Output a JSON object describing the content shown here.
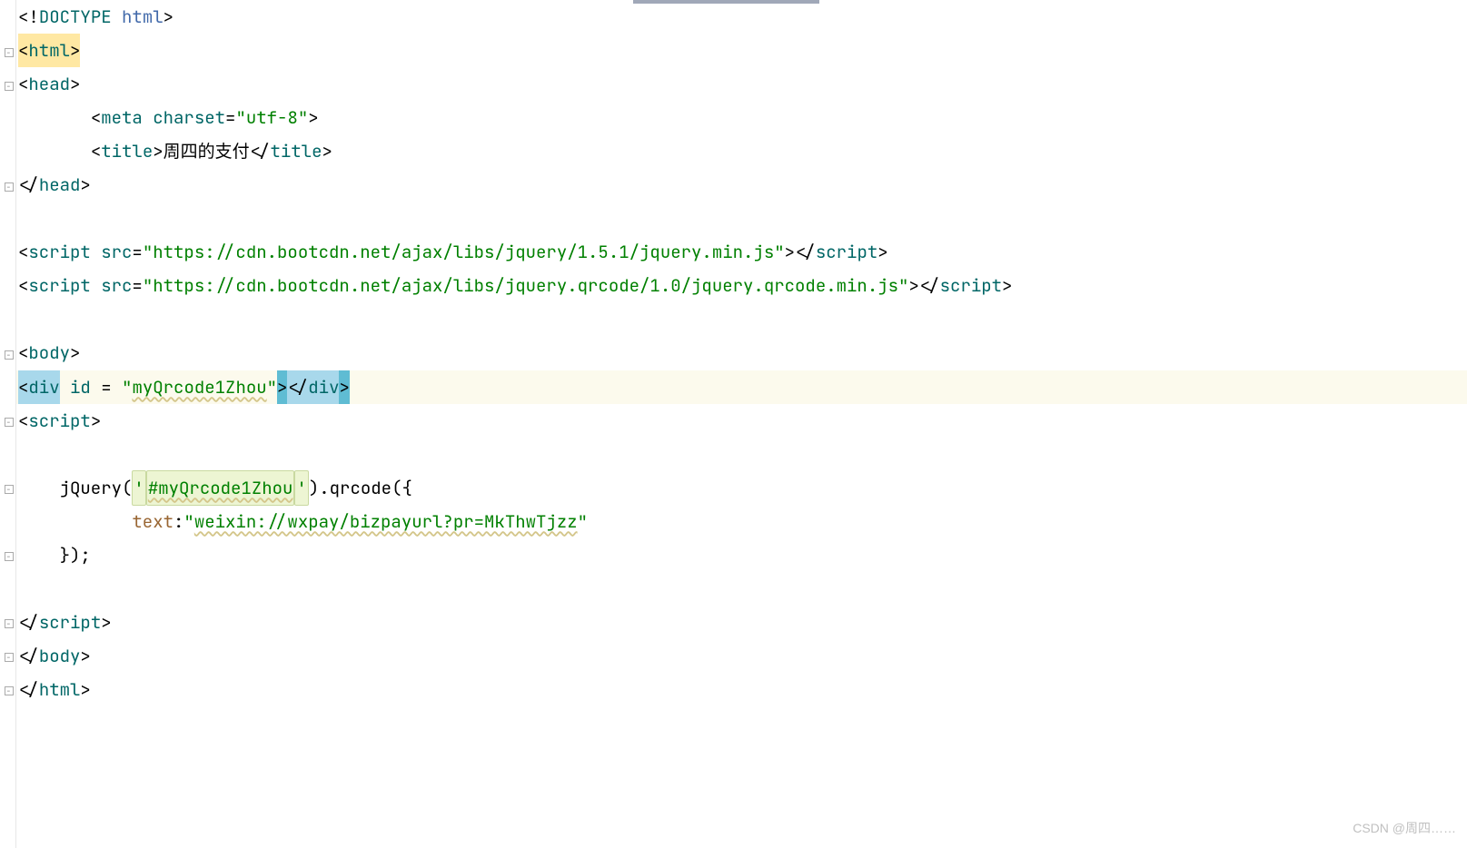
{
  "code": {
    "lines": [
      {
        "fold": "",
        "segments": [
          {
            "text": "<!",
            "cls": "t-bracket"
          },
          {
            "text": "DOCTYPE ",
            "cls": "t-tag"
          },
          {
            "text": "html",
            "cls": "t-identifier"
          },
          {
            "text": ">",
            "cls": "t-bracket"
          }
        ]
      },
      {
        "fold": "open",
        "segments": [
          {
            "text": "<",
            "cls": "t-bracket hl-html"
          },
          {
            "text": "html",
            "cls": "t-tag hl-html"
          },
          {
            "text": ">",
            "cls": "t-bracket hl-html"
          }
        ]
      },
      {
        "fold": "open",
        "segments": [
          {
            "text": "<",
            "cls": "t-bracket"
          },
          {
            "text": "head",
            "cls": "t-tag"
          },
          {
            "text": ">",
            "cls": "t-bracket"
          }
        ]
      },
      {
        "fold": "",
        "segments": [
          {
            "text": "       ",
            "cls": ""
          },
          {
            "text": "<",
            "cls": "t-bracket"
          },
          {
            "text": "meta ",
            "cls": "t-tag"
          },
          {
            "text": "charset",
            "cls": "t-attr"
          },
          {
            "text": "=",
            "cls": "t-punct"
          },
          {
            "text": "\"utf-8\"",
            "cls": "t-string"
          },
          {
            "text": ">",
            "cls": "t-bracket"
          }
        ]
      },
      {
        "fold": "",
        "segments": [
          {
            "text": "       ",
            "cls": ""
          },
          {
            "text": "<",
            "cls": "t-bracket"
          },
          {
            "text": "title",
            "cls": "t-tag"
          },
          {
            "text": ">",
            "cls": "t-bracket"
          },
          {
            "text": "周四的支付",
            "cls": "t-text"
          },
          {
            "text": "</",
            "cls": "t-bracket"
          },
          {
            "text": "title",
            "cls": "t-tag"
          },
          {
            "text": ">",
            "cls": "t-bracket"
          }
        ]
      },
      {
        "fold": "close",
        "segments": [
          {
            "text": "</",
            "cls": "t-bracket"
          },
          {
            "text": "head",
            "cls": "t-tag"
          },
          {
            "text": ">",
            "cls": "t-bracket"
          }
        ]
      },
      {
        "fold": "",
        "segments": [
          {
            "text": " ",
            "cls": ""
          }
        ]
      },
      {
        "fold": "",
        "segments": [
          {
            "text": "<",
            "cls": "t-bracket"
          },
          {
            "text": "script ",
            "cls": "t-tag"
          },
          {
            "text": "src",
            "cls": "t-attr"
          },
          {
            "text": "=",
            "cls": "t-punct"
          },
          {
            "text": "\"https://cdn.bootcdn.net/ajax/libs/jquery/1.5.1/jquery.min.js\"",
            "cls": "t-string"
          },
          {
            "text": "></",
            "cls": "t-bracket"
          },
          {
            "text": "script",
            "cls": "t-tag"
          },
          {
            "text": ">",
            "cls": "t-bracket"
          }
        ]
      },
      {
        "fold": "",
        "segments": [
          {
            "text": "<",
            "cls": "t-bracket"
          },
          {
            "text": "script ",
            "cls": "t-tag"
          },
          {
            "text": "src",
            "cls": "t-attr"
          },
          {
            "text": "=",
            "cls": "t-punct"
          },
          {
            "text": "\"https://cdn.bootcdn.net/ajax/libs/jquery.qrcode/1.0/jquery.qrcode.min.js\"",
            "cls": "t-string"
          },
          {
            "text": "></",
            "cls": "t-bracket"
          },
          {
            "text": "script",
            "cls": "t-tag"
          },
          {
            "text": ">",
            "cls": "t-bracket"
          }
        ]
      },
      {
        "fold": "",
        "segments": [
          {
            "text": " ",
            "cls": ""
          }
        ]
      },
      {
        "fold": "open",
        "segments": [
          {
            "text": "<",
            "cls": "t-bracket"
          },
          {
            "text": "body",
            "cls": "t-tag"
          },
          {
            "text": ">",
            "cls": "t-bracket"
          }
        ]
      },
      {
        "fold": "",
        "current": true,
        "segments": [
          {
            "text": "<",
            "cls": "t-bracket hl-tag-sel"
          },
          {
            "text": "div",
            "cls": "t-tag hl-tag-sel"
          },
          {
            "text": " ",
            "cls": ""
          },
          {
            "text": "id ",
            "cls": "t-attr"
          },
          {
            "text": "= ",
            "cls": "t-punct"
          },
          {
            "text": "\"",
            "cls": "t-string"
          },
          {
            "text": "myQrcode1Zhou",
            "cls": "t-string t-underline-wavy"
          },
          {
            "text": "\"",
            "cls": "t-string"
          },
          {
            "text": ">",
            "cls": "t-bracket hl-tag-sel2"
          },
          {
            "text": "</",
            "cls": "t-bracket hl-tag-sel"
          },
          {
            "text": "div",
            "cls": "t-tag hl-tag-sel"
          },
          {
            "text": ">",
            "cls": "t-bracket hl-tag-sel2"
          }
        ]
      },
      {
        "fold": "open",
        "segments": [
          {
            "text": "<",
            "cls": "t-bracket"
          },
          {
            "text": "script",
            "cls": "t-tag"
          },
          {
            "text": ">",
            "cls": "t-bracket"
          }
        ]
      },
      {
        "fold": "",
        "segments": [
          {
            "text": " ",
            "cls": ""
          }
        ]
      },
      {
        "fold": "open",
        "segments": [
          {
            "text": "    ",
            "cls": ""
          },
          {
            "text": "jQuery",
            "cls": "t-func"
          },
          {
            "text": "(",
            "cls": "t-punct"
          },
          {
            "text": "'",
            "cls": "t-string hl-soft"
          },
          {
            "text": "#myQrcode1Zhou",
            "cls": "t-string hl-soft t-underline-wavy"
          },
          {
            "text": "'",
            "cls": "t-string hl-soft"
          },
          {
            "text": ").",
            "cls": "t-punct"
          },
          {
            "text": "qrcode",
            "cls": "t-func"
          },
          {
            "text": "({",
            "cls": "t-punct"
          }
        ]
      },
      {
        "fold": "",
        "segments": [
          {
            "text": "           ",
            "cls": ""
          },
          {
            "text": "text",
            "cls": "t-prop"
          },
          {
            "text": ":",
            "cls": "t-punct"
          },
          {
            "text": "\"",
            "cls": "t-string"
          },
          {
            "text": "weixin://wxpay/bizpayurl?pr=MkThwTjzz",
            "cls": "t-string t-underline-wavy"
          },
          {
            "text": "\"",
            "cls": "t-string"
          }
        ]
      },
      {
        "fold": "close",
        "segments": [
          {
            "text": "    });",
            "cls": "t-punct"
          }
        ]
      },
      {
        "fold": "",
        "segments": [
          {
            "text": " ",
            "cls": ""
          }
        ]
      },
      {
        "fold": "close",
        "segments": [
          {
            "text": "</",
            "cls": "t-bracket"
          },
          {
            "text": "script",
            "cls": "t-tag"
          },
          {
            "text": ">",
            "cls": "t-bracket"
          }
        ]
      },
      {
        "fold": "close",
        "segments": [
          {
            "text": "</",
            "cls": "t-bracket"
          },
          {
            "text": "body",
            "cls": "t-tag"
          },
          {
            "text": ">",
            "cls": "t-bracket"
          }
        ]
      },
      {
        "fold": "close",
        "segments": [
          {
            "text": "</",
            "cls": "t-bracket"
          },
          {
            "text": "html",
            "cls": "t-tag"
          },
          {
            "text": ">",
            "cls": "t-bracket"
          }
        ]
      }
    ]
  },
  "watermark": "CSDN @周四……"
}
